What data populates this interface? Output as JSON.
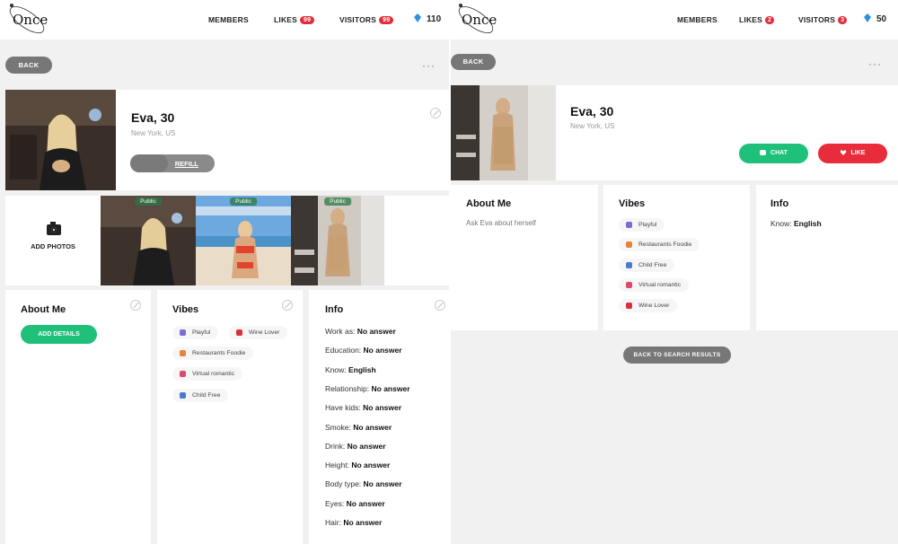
{
  "brand": {
    "logo_text": "Once"
  },
  "left": {
    "nav": {
      "members": "MEMBERS",
      "likes": "LIKES",
      "likes_count": "99",
      "visitors": "VISITORS",
      "visitors_count": "99",
      "credits": "110"
    },
    "back_label": "BACK",
    "more_label": "···",
    "profile": {
      "name": "Eva, 30",
      "location": "New York, US",
      "refill_label": "REFILL"
    },
    "add_photos_label": "ADD PHOTOS",
    "photos": [
      {
        "tag": "Public"
      },
      {
        "tag": "Public"
      },
      {
        "tag": "Public"
      }
    ],
    "about": {
      "title": "About Me",
      "button": "ADD DETAILS"
    },
    "vibes": {
      "title": "Vibes",
      "items": [
        "Playful",
        "Wine Lover",
        "Restaurants Foodie",
        "Virtual romantic",
        "Child Free"
      ]
    },
    "info": {
      "title": "Info",
      "rows": [
        {
          "label": "Work as:",
          "value": "No answer"
        },
        {
          "label": "Education:",
          "value": "No answer"
        },
        {
          "label": "Know:",
          "value": "English"
        },
        {
          "label": "Relationship:",
          "value": "No answer"
        },
        {
          "label": "Have kids:",
          "value": "No answer"
        },
        {
          "label": "Smoke:",
          "value": "No answer"
        },
        {
          "label": "Drink:",
          "value": "No answer"
        },
        {
          "label": "Height:",
          "value": "No answer"
        },
        {
          "label": "Body type:",
          "value": "No answer"
        },
        {
          "label": "Eyes:",
          "value": "No answer"
        },
        {
          "label": "Hair:",
          "value": "No answer"
        }
      ]
    }
  },
  "right": {
    "nav": {
      "members": "MEMBERS",
      "likes": "LIKES",
      "likes_count": "2",
      "visitors": "VISITORS",
      "visitors_count": "3",
      "credits": "50"
    },
    "back_label": "BACK",
    "more_label": "···",
    "profile": {
      "name": "Eva, 30",
      "location": "New York, US",
      "chat_label": "CHAT",
      "like_label": "LIKE"
    },
    "about": {
      "title": "About Me",
      "text": "Ask Eva about herself"
    },
    "vibes": {
      "title": "Vibes",
      "items": [
        "Playful",
        "Restaurants Foodie",
        "Child Free",
        "Virtual romantic",
        "Wine Lover"
      ]
    },
    "info": {
      "title": "Info",
      "rows": [
        {
          "label": "Know:",
          "value": "English"
        }
      ]
    },
    "back_to_search_label": "BACK TO SEARCH RESULTS"
  }
}
